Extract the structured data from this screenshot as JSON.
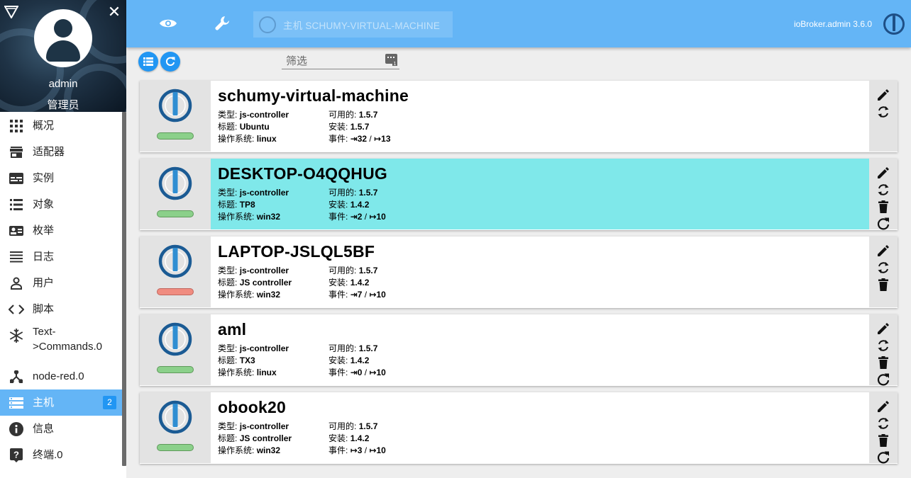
{
  "sidebar": {
    "user": {
      "name": "admin",
      "role": "管理员"
    },
    "items": [
      {
        "label": "概况",
        "icon": "apps-grid-icon"
      },
      {
        "label": "适配器",
        "icon": "store-icon"
      },
      {
        "label": "实例",
        "icon": "instances-icon"
      },
      {
        "label": "对象",
        "icon": "list-icon"
      },
      {
        "label": "枚举",
        "icon": "enum-card-icon"
      },
      {
        "label": "日志",
        "icon": "log-lines-icon"
      },
      {
        "label": "用户",
        "icon": "person-icon"
      },
      {
        "label": "脚本",
        "icon": "code-icon"
      },
      {
        "label": "Text->Commands.0",
        "label_line1": "Text-",
        "label_line2": ">Commands.0",
        "icon": "snowflake-icon"
      },
      {
        "label": "node-red.0",
        "icon": "node-red-icon"
      },
      {
        "label": "主机",
        "icon": "hosts-icon",
        "active": true,
        "badge": "2"
      },
      {
        "label": "信息",
        "icon": "info-icon"
      },
      {
        "label": "终端.0",
        "icon": "help-icon"
      }
    ]
  },
  "topbar": {
    "host_label": "主机 SCHUMY-VIRTUAL-MACHINE",
    "version": "ioBroker.admin 3.6.0"
  },
  "toolbar": {
    "filter_placeholder": "筛选"
  },
  "field_labels": {
    "type": "类型:",
    "title": "标题:",
    "os": "操作系统:",
    "available": "可用的:",
    "installed": "安装:",
    "events": "事件:"
  },
  "hosts": [
    {
      "name": "schumy-virtual-machine",
      "type": "js-controller",
      "title": "Ubuntu",
      "os": "linux",
      "available": "1.5.7",
      "installed": "1.5.7",
      "events_in": "⇥32",
      "events_out": "↦13",
      "status": "ok",
      "highlighted": false,
      "actions": [
        "edit",
        "update"
      ]
    },
    {
      "name": "DESKTOP-O4QQHUG",
      "type": "js-controller",
      "title": "TP8",
      "os": "win32",
      "available": "1.5.7",
      "installed": "1.4.2",
      "events_in": "⇥2",
      "events_out": "↦10",
      "status": "ok",
      "highlighted": true,
      "actions": [
        "edit",
        "update",
        "delete",
        "restart"
      ]
    },
    {
      "name": "LAPTOP-JSLQL5BF",
      "type": "js-controller",
      "title": "JS controller",
      "os": "win32",
      "available": "1.5.7",
      "installed": "1.4.2",
      "events_in": "⇥7",
      "events_out": "↦10",
      "status": "error",
      "highlighted": false,
      "actions": [
        "edit",
        "update",
        "delete"
      ]
    },
    {
      "name": "aml",
      "type": "js-controller",
      "title": "TX3",
      "os": "linux",
      "available": "1.5.7",
      "installed": "1.4.2",
      "events_in": "⇥0",
      "events_out": "↦10",
      "status": "ok",
      "highlighted": false,
      "actions": [
        "edit",
        "update",
        "delete",
        "restart"
      ]
    },
    {
      "name": "obook20",
      "type": "js-controller",
      "title": "JS controller",
      "os": "win32",
      "available": "1.5.7",
      "installed": "1.4.2",
      "events_in": "↦3",
      "events_out": "↦10",
      "status": "ok",
      "highlighted": false,
      "actions": [
        "edit",
        "update",
        "delete",
        "restart"
      ]
    }
  ],
  "colors": {
    "topbar": "#64b5f6",
    "accent": "#2196f3",
    "highlight_row": "#7fe8ea",
    "status_ok": "#8bd08a",
    "status_error": "#f08c80"
  }
}
